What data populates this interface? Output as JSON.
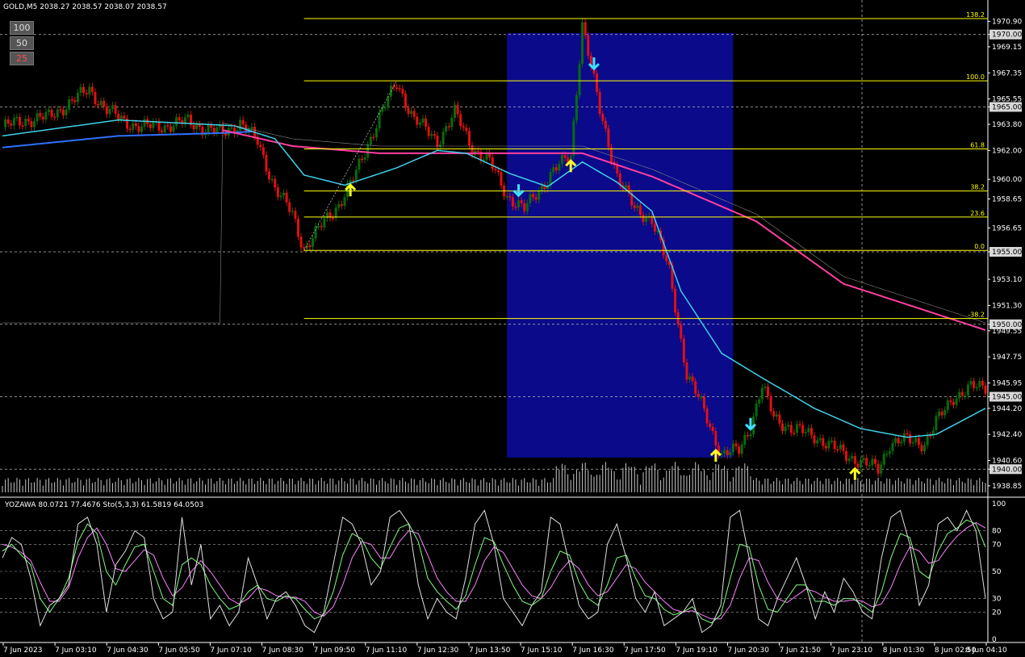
{
  "header": {
    "symbol_title": "GOLD,M5  2038.27 2038.57 2038.07 2038.57",
    "indicator_title": "YOZAWA 80.0721 77.4676  Sto(5,3,3) 61.5819 64.0503"
  },
  "buttons": [
    {
      "label": "100",
      "color": "#9a9a9a"
    },
    {
      "label": "50",
      "color": "#9a9a9a"
    },
    {
      "label": "25",
      "color": "#e04040"
    }
  ],
  "colors": {
    "background": "#000000",
    "bull": "#0a6b0a",
    "bear": "#e01010",
    "fib": "#ffff00",
    "ma_fast": "#40d0e8",
    "ma_slow": "#ff40a0",
    "ma_blue": "#3070ff",
    "highlight": "#0a0a8a",
    "stoch_main": "#e0e0e0",
    "stoch_k": "#80ff80",
    "stoch_d": "#ff80ff"
  },
  "chart_data": [
    {
      "type": "candlestick",
      "title": "GOLD,M5",
      "y_ticks": [
        "1970.90",
        "1970.00",
        "1969.15",
        "1967.35",
        "1965.55",
        "1965.00",
        "1963.80",
        "1962.00",
        "1960.00",
        "1958.65",
        "1956.65",
        "1955.00",
        "1953.10",
        "1951.30",
        "1950.00",
        "1949.55",
        "1947.75",
        "1945.95",
        "1945.00",
        "1944.20",
        "1942.40",
        "1940.60",
        "1940.00",
        "1938.85"
      ],
      "ylim": [
        1938.4,
        1971.6
      ],
      "x_ticks": [
        "7 Jun 2023",
        "7 Jun 03:10",
        "7 Jun 04:30",
        "7 Jun 05:50",
        "7 Jun 07:10",
        "7 Jun 08:30",
        "7 Jun 09:50",
        "7 Jun 11:10",
        "7 Jun 12:30",
        "7 Jun 13:50",
        "7 Jun 15:10",
        "7 Jun 16:30",
        "7 Jun 17:50",
        "7 Jun 19:10",
        "7 Jun 20:30",
        "7 Jun 21:50",
        "7 Jun 23:10",
        "8 Jun 01:30",
        "8 Jun 02:50",
        "8 Jun 04:10"
      ],
      "price_anchors": [
        [
          0,
          1963.6
        ],
        [
          8,
          1964.1
        ],
        [
          16,
          1964.3
        ],
        [
          24,
          1965.4
        ],
        [
          30,
          1966.2
        ],
        [
          36,
          1964.8
        ],
        [
          42,
          1964.0
        ],
        [
          48,
          1963.6
        ],
        [
          56,
          1963.7
        ],
        [
          64,
          1964.0
        ],
        [
          70,
          1963.5
        ],
        [
          76,
          1963.2
        ],
        [
          82,
          1963.9
        ],
        [
          88,
          1962.6
        ],
        [
          94,
          1959.4
        ],
        [
          100,
          1957.6
        ],
        [
          104,
          1955.2
        ],
        [
          110,
          1956.8
        ],
        [
          116,
          1958.3
        ],
        [
          122,
          1960.4
        ],
        [
          130,
          1964.4
        ],
        [
          136,
          1966.6
        ],
        [
          142,
          1964.2
        ],
        [
          150,
          1962.6
        ],
        [
          156,
          1964.6
        ],
        [
          162,
          1962.2
        ],
        [
          168,
          1961.2
        ],
        [
          174,
          1958.9
        ],
        [
          180,
          1957.9
        ],
        [
          186,
          1959.5
        ],
        [
          190,
          1960.6
        ],
        [
          196,
          1961.6
        ],
        [
          200,
          1970.8
        ],
        [
          206,
          1964.7
        ],
        [
          212,
          1960.3
        ],
        [
          218,
          1957.9
        ],
        [
          224,
          1957.3
        ],
        [
          230,
          1953.6
        ],
        [
          236,
          1946.6
        ],
        [
          242,
          1944.0
        ],
        [
          248,
          1941.0
        ],
        [
          254,
          1941.3
        ],
        [
          258,
          1943.0
        ],
        [
          262,
          1945.7
        ],
        [
          266,
          1943.6
        ],
        [
          272,
          1942.8
        ],
        [
          280,
          1942.3
        ],
        [
          288,
          1941.3
        ],
        [
          296,
          1940.5
        ],
        [
          302,
          1940.0
        ],
        [
          306,
          1941.8
        ],
        [
          312,
          1942.0
        ],
        [
          318,
          1941.8
        ],
        [
          322,
          1943.2
        ],
        [
          328,
          1945.0
        ],
        [
          334,
          1945.6
        ],
        [
          339,
          1945.7
        ]
      ],
      "ma_fast_anchors": [
        [
          0,
          1963.0
        ],
        [
          40,
          1964.1
        ],
        [
          80,
          1963.7
        ],
        [
          94,
          1962.8
        ],
        [
          104,
          1960.3
        ],
        [
          118,
          1959.6
        ],
        [
          136,
          1960.8
        ],
        [
          150,
          1962.0
        ],
        [
          160,
          1961.8
        ],
        [
          175,
          1960.4
        ],
        [
          188,
          1959.5
        ],
        [
          200,
          1961.2
        ],
        [
          212,
          1959.8
        ],
        [
          224,
          1957.8
        ],
        [
          234,
          1952.3
        ],
        [
          248,
          1948.0
        ],
        [
          262,
          1946.3
        ],
        [
          280,
          1944.2
        ],
        [
          296,
          1942.8
        ],
        [
          312,
          1942.2
        ],
        [
          322,
          1942.4
        ],
        [
          339,
          1944.2
        ]
      ],
      "ma_slow_anchors": [
        [
          76,
          1963.4
        ],
        [
          100,
          1962.3
        ],
        [
          130,
          1961.8
        ],
        [
          200,
          1961.8
        ],
        [
          224,
          1960.2
        ],
        [
          260,
          1957.1
        ],
        [
          290,
          1952.8
        ],
        [
          339,
          1949.6
        ]
      ],
      "ma_blue_anchors": [
        [
          0,
          1962.2
        ],
        [
          40,
          1963.0
        ],
        [
          76,
          1963.2
        ],
        [
          86,
          1963.3
        ]
      ],
      "fib_levels": [
        {
          "label": "138.2",
          "value": 1971.1
        },
        {
          "label": "100.0",
          "value": 1966.8
        },
        {
          "label": "61.8",
          "value": 1962.1
        },
        {
          "label": "38.2",
          "value": 1959.2
        },
        {
          "label": "23.6",
          "value": 1957.4
        },
        {
          "label": "0.0",
          "value": 1955.1
        },
        {
          "label": "-38.2",
          "value": 1950.4
        }
      ],
      "h_dashed_levels": [
        1970.0,
        1965.0,
        1955.0,
        1950.0,
        1945.0,
        1940.0
      ],
      "highlight_range": {
        "from_bar": 174,
        "to_bar": 252,
        "top": 1970.1,
        "bottom": 1940.8
      },
      "signals": [
        {
          "bar": 120,
          "dir": "up",
          "color": "#ffff20"
        },
        {
          "bar": 178,
          "dir": "down",
          "color": "#40e0ff"
        },
        {
          "bar": 196,
          "dir": "up",
          "color": "#ffff20"
        },
        {
          "bar": 204,
          "dir": "down",
          "color": "#40e0ff"
        },
        {
          "bar": 246,
          "dir": "up",
          "color": "#ffff20"
        },
        {
          "bar": 258,
          "dir": "down",
          "color": "#40e0ff"
        },
        {
          "bar": 294,
          "dir": "up",
          "color": "#ffff20"
        }
      ]
    },
    {
      "type": "line",
      "title": "YOZAWA / Sto(5,3,3)",
      "y_ticks": [
        "100",
        "80",
        "70",
        "50",
        "30",
        "20",
        "0"
      ],
      "ylim": [
        0,
        100
      ],
      "levels": [
        80,
        70,
        50,
        30,
        20
      ],
      "yozawa": [
        60,
        75,
        70,
        45,
        10,
        25,
        30,
        40,
        85,
        90,
        70,
        20,
        55,
        65,
        80,
        75,
        30,
        15,
        20,
        90,
        40,
        70,
        15,
        25,
        10,
        20,
        60,
        40,
        15,
        30,
        35,
        25,
        10,
        5,
        20,
        55,
        90,
        85,
        70,
        40,
        50,
        90,
        95,
        85,
        40,
        15,
        30,
        20,
        15,
        45,
        85,
        95,
        70,
        30,
        20,
        10,
        25,
        35,
        90,
        85,
        55,
        25,
        15,
        20,
        70,
        85,
        60,
        30,
        20,
        35,
        10,
        15,
        20,
        30,
        5,
        10,
        25,
        90,
        95,
        60,
        15,
        10,
        30,
        45,
        60,
        40,
        15,
        35,
        20,
        45,
        35,
        20,
        15,
        60,
        90,
        95,
        70,
        25,
        40,
        85,
        90,
        80,
        95,
        80,
        30
      ],
      "stoch_k": [
        65,
        70,
        62,
        55,
        30,
        20,
        30,
        45,
        72,
        85,
        78,
        50,
        40,
        55,
        68,
        70,
        50,
        30,
        25,
        55,
        60,
        55,
        40,
        30,
        22,
        25,
        35,
        40,
        30,
        28,
        32,
        30,
        22,
        15,
        18,
        35,
        62,
        78,
        74,
        60,
        52,
        68,
        82,
        85,
        72,
        45,
        35,
        28,
        22,
        32,
        55,
        75,
        72,
        55,
        40,
        28,
        25,
        30,
        50,
        65,
        62,
        42,
        30,
        25,
        40,
        60,
        62,
        45,
        32,
        30,
        22,
        18,
        20,
        24,
        15,
        12,
        18,
        45,
        70,
        68,
        40,
        22,
        20,
        30,
        40,
        40,
        28,
        28,
        25,
        30,
        30,
        25,
        20,
        35,
        60,
        78,
        75,
        50,
        45,
        65,
        78,
        82,
        88,
        85,
        68
      ],
      "stoch_d": [
        70,
        68,
        64,
        58,
        42,
        28,
        28,
        38,
        60,
        75,
        82,
        70,
        52,
        50,
        58,
        66,
        62,
        45,
        32,
        38,
        50,
        58,
        50,
        40,
        30,
        26,
        30,
        38,
        36,
        32,
        31,
        31,
        28,
        20,
        17,
        24,
        40,
        60,
        72,
        70,
        60,
        60,
        72,
        80,
        78,
        62,
        45,
        35,
        28,
        28,
        40,
        58,
        68,
        64,
        52,
        40,
        32,
        30,
        38,
        50,
        58,
        52,
        40,
        32,
        35,
        45,
        55,
        52,
        42,
        35,
        28,
        22,
        20,
        21,
        18,
        15,
        15,
        25,
        45,
        60,
        58,
        42,
        30,
        27,
        32,
        37,
        35,
        31,
        28,
        28,
        29,
        28,
        24,
        26,
        38,
        55,
        68,
        65,
        56,
        58,
        68,
        76,
        82,
        86,
        82
      ]
    }
  ]
}
